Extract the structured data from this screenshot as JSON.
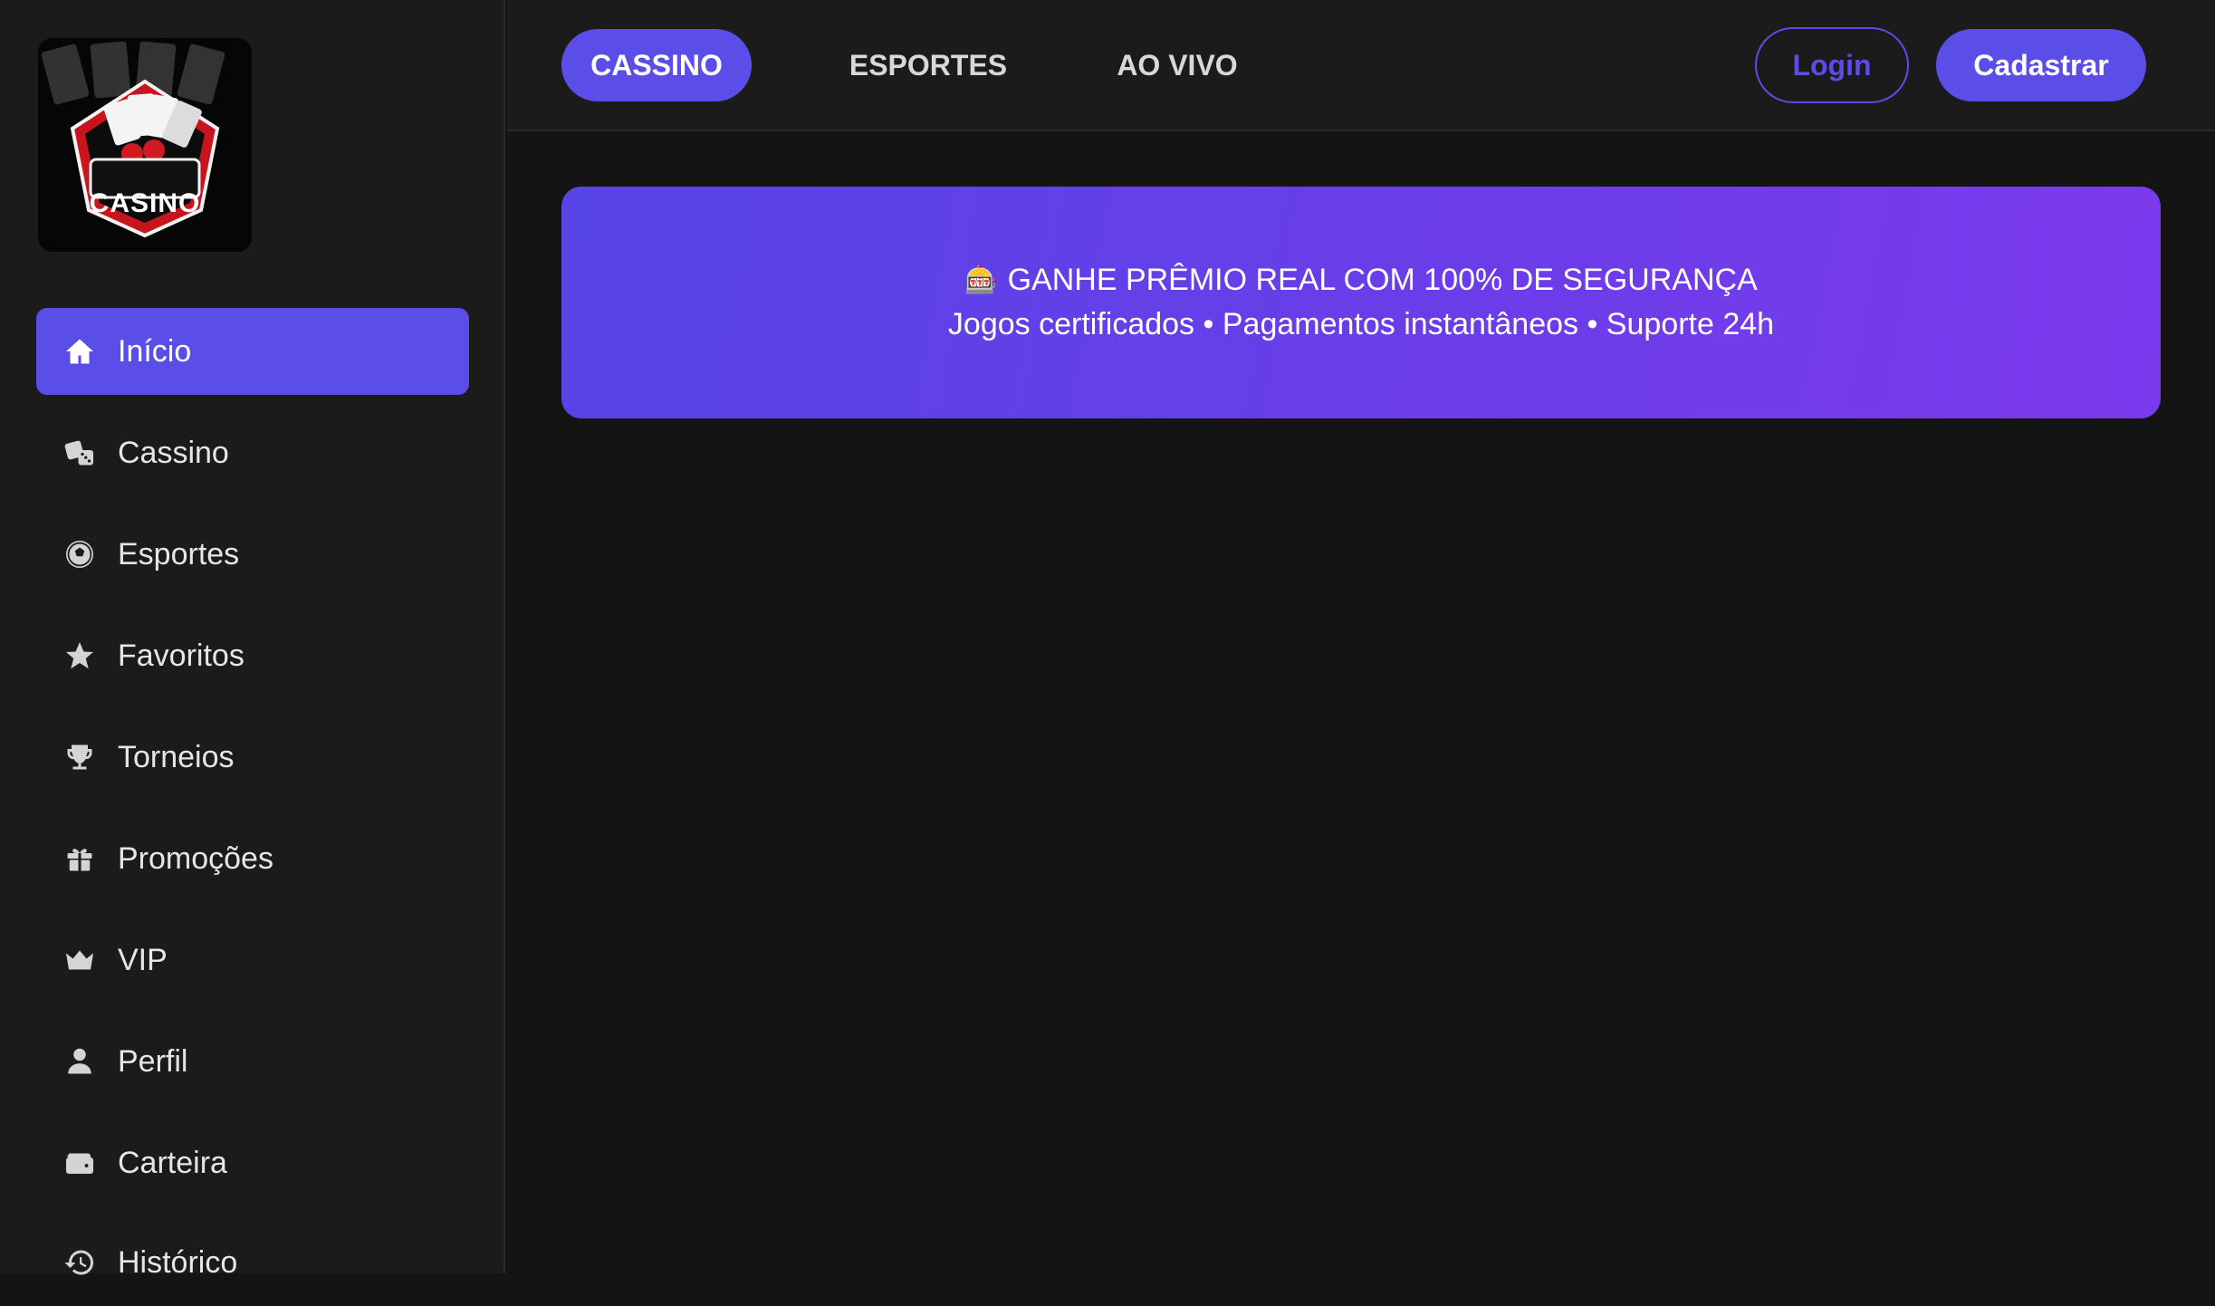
{
  "sidebar": {
    "logo_text": "CASINO",
    "items": [
      {
        "label": "Início",
        "icon": "home-icon"
      },
      {
        "label": "Cassino",
        "icon": "dice-icon"
      },
      {
        "label": "Esportes",
        "icon": "soccer-ball-icon"
      },
      {
        "label": "Favoritos",
        "icon": "star-icon"
      },
      {
        "label": "Torneios",
        "icon": "trophy-icon"
      },
      {
        "label": "Promoções",
        "icon": "gift-icon"
      },
      {
        "label": "VIP",
        "icon": "crown-icon"
      },
      {
        "label": "Perfil",
        "icon": "user-icon"
      },
      {
        "label": "Carteira",
        "icon": "wallet-icon"
      },
      {
        "label": "Histórico",
        "icon": "history-icon"
      }
    ]
  },
  "header": {
    "tabs": [
      {
        "label": "CASSINO"
      },
      {
        "label": "ESPORTES"
      },
      {
        "label": "AO VIVO"
      }
    ],
    "login_label": "Login",
    "register_label": "Cadastrar"
  },
  "banner": {
    "icon": "🎰",
    "title": "GANHE PRÊMIO REAL COM 100% DE SEGURANÇA",
    "subtitle": "Jogos certificados • Pagamentos instantâneos • Suporte 24h"
  },
  "colors": {
    "accent": "#5b4ee8",
    "background": "#141414",
    "sidebar": "#1b1b1b"
  }
}
